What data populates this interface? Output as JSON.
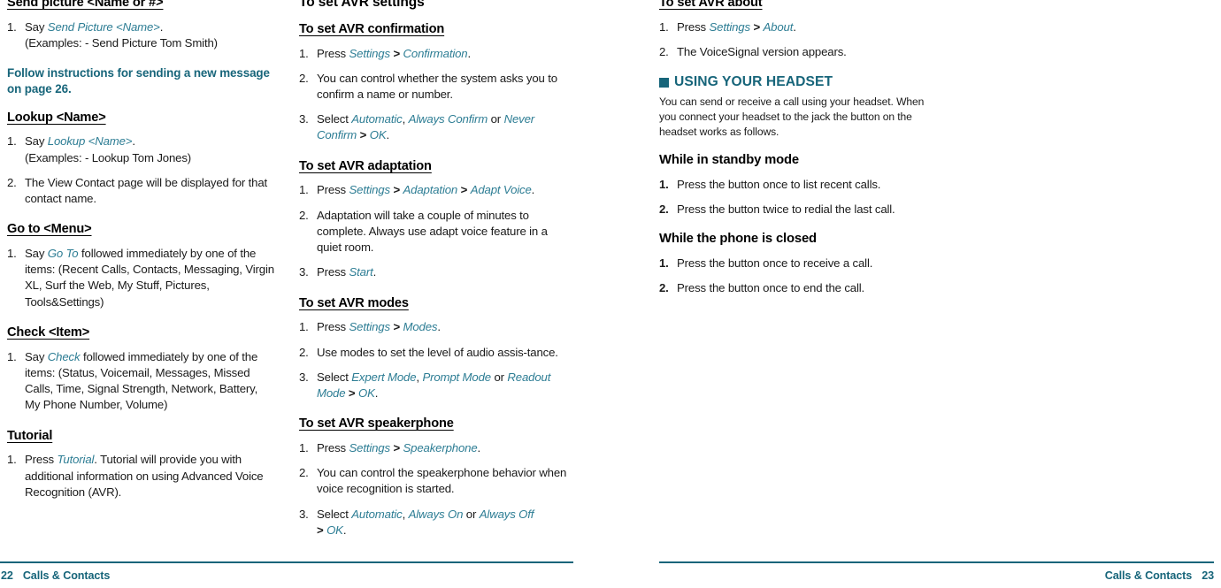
{
  "left_page": {
    "column1": {
      "blocks": [
        {
          "kind": "heading-underline",
          "text": "Send picture <Name or #>"
        },
        {
          "kind": "steps",
          "items": [
            {
              "num": "1.",
              "html": "Say <em class=\"ac\">Send Picture &lt;Name&gt;</em>.<br>(Examples: - Send Picture Tom Smith)"
            }
          ]
        },
        {
          "kind": "callout",
          "text": "Follow instructions for sending a new message on page 26."
        },
        {
          "kind": "heading-underline",
          "text": "Lookup <Name>"
        },
        {
          "kind": "steps",
          "items": [
            {
              "num": "1.",
              "html": "Say <em class=\"ac\">Lookup &lt;Name&gt;</em>.<br>(Examples: - Lookup Tom Jones)"
            },
            {
              "num": "2.",
              "html": "The View Contact page will be displayed for that contact name."
            }
          ]
        },
        {
          "kind": "heading-underline",
          "text": "Go to <Menu>"
        },
        {
          "kind": "steps",
          "items": [
            {
              "num": "1.",
              "html": "Say <em class=\"ac\">Go To</em> followed immediately by one of the items: (Recent Calls, Contacts, Messaging, Virgin XL, Surf the Web, My Stuff, Pictures, Tools&amp;Settings)"
            }
          ]
        },
        {
          "kind": "heading-underline",
          "text": "Check <Item>"
        },
        {
          "kind": "steps",
          "items": [
            {
              "num": "1.",
              "html": "Say <em class=\"ac\">Check</em> followed immediately by one of the items: (Status, Voicemail, Messages, Missed Calls, Time, Signal Strength, Network, Battery, My Phone Number, Volume)"
            }
          ]
        },
        {
          "kind": "heading-underline",
          "text": "Tutorial"
        },
        {
          "kind": "steps",
          "items": [
            {
              "num": "1.",
              "html": "Press <em class=\"ac\">Tutorial</em>. Tutorial will provide you with additional information on using Advanced Voice Recognition (AVR)."
            }
          ]
        }
      ]
    },
    "column2": {
      "blocks": [
        {
          "kind": "heading-section",
          "text": "To set AVR settings"
        },
        {
          "kind": "heading-underline",
          "text": "To set AVR confirmation"
        },
        {
          "kind": "steps",
          "items": [
            {
              "num": "1.",
              "html": "Press <em class=\"ac\">Settings</em> <span class=\"gt\">&gt;</span> <em class=\"ac\">Confirmation</em>."
            },
            {
              "num": "2.",
              "html": "You can control whether the system asks you to confirm a name or number."
            },
            {
              "num": "3.",
              "html": "Select <em class=\"ac\">Automatic</em>, <em class=\"ac\">Always Confirm</em> or <em class=\"ac\">Never Confirm</em> <span class=\"gt\">&gt;</span> <em class=\"ac\">OK</em>."
            }
          ]
        },
        {
          "kind": "heading-underline",
          "text": "To set AVR adaptation"
        },
        {
          "kind": "steps",
          "items": [
            {
              "num": "1.",
              "html": "Press <em class=\"ac\">Settings</em> <span class=\"gt\">&gt;</span> <em class=\"ac\">Adaptation</em> <span class=\"gt\">&gt;</span> <em class=\"ac\">Adapt Voice</em>."
            },
            {
              "num": "2.",
              "html": "Adaptation will take a couple of minutes to complete. Always use adapt voice feature in a quiet room."
            },
            {
              "num": "3.",
              "html": "Press <em class=\"ac\">Start</em>."
            }
          ]
        },
        {
          "kind": "heading-underline",
          "text": "To set AVR modes"
        },
        {
          "kind": "steps",
          "items": [
            {
              "num": "1.",
              "html": "Press <em class=\"ac\">Settings</em> <span class=\"gt\">&gt;</span> <em class=\"ac\">Modes</em>."
            },
            {
              "num": "2.",
              "html": "Use modes to set the level of audio assis-tance."
            },
            {
              "num": "3.",
              "html": "Select <em class=\"ac\">Expert Mode</em>, <em class=\"ac\">Prompt Mode</em> or <em class=\"ac\">Readout Mode</em> <span class=\"gt\">&gt;</span> <em class=\"ac\">OK</em>."
            }
          ]
        },
        {
          "kind": "heading-underline",
          "text": "To set AVR speakerphone"
        },
        {
          "kind": "steps",
          "items": [
            {
              "num": "1.",
              "html": "Press <em class=\"ac\">Settings</em> <span class=\"gt\">&gt;</span> <em class=\"ac\">Speakerphone</em>."
            },
            {
              "num": "2.",
              "html": "You can control the speakerphone behavior when voice recognition is started."
            },
            {
              "num": "3.",
              "html": "Select <em class=\"ac\">Automatic</em>, <em class=\"ac\">Always On</em> or <em class=\"ac\">Always Off</em><br><span class=\"gt\">&gt;</span> <em class=\"ac\">OK</em>."
            }
          ]
        }
      ]
    },
    "footer": {
      "page_number": "22",
      "title": "Calls & Contacts"
    }
  },
  "right_page": {
    "column1": {
      "blocks": [
        {
          "kind": "heading-underline",
          "text": "To set AVR about"
        },
        {
          "kind": "steps",
          "items": [
            {
              "num": "1.",
              "html": "Press <em class=\"ac\">Settings</em> <span class=\"gt\">&gt;</span> <em class=\"ac\">About</em>."
            },
            {
              "num": "2.",
              "html": "The VoiceSignal version appears."
            }
          ]
        },
        {
          "kind": "heading-chapter",
          "text": "USING YOUR HEADSET",
          "bullet_icon": "square-bullet-icon"
        },
        {
          "kind": "intro",
          "text": "You can send or receive a call using your headset. When you connect your headset to the jack the button on the headset works as follows."
        },
        {
          "kind": "heading-plain",
          "text": "While in standby mode"
        },
        {
          "kind": "steps-bold-num",
          "items": [
            {
              "num": "1.",
              "html": "Press the button once to list recent calls."
            },
            {
              "num": "2.",
              "html": "Press the button twice to redial the last call."
            }
          ]
        },
        {
          "kind": "heading-plain",
          "text": "While the phone is closed"
        },
        {
          "kind": "steps-bold-num",
          "items": [
            {
              "num": "1.",
              "html": "Press the button once to receive a call."
            },
            {
              "num": "2.",
              "html": "Press the button once to end the call."
            }
          ]
        }
      ]
    },
    "footer": {
      "page_number": "23",
      "title": "Calls & Contacts"
    }
  },
  "colors": {
    "teal": "#17657a",
    "accent_italic": "#2d7d94",
    "body_text": "#1a1a1a"
  }
}
